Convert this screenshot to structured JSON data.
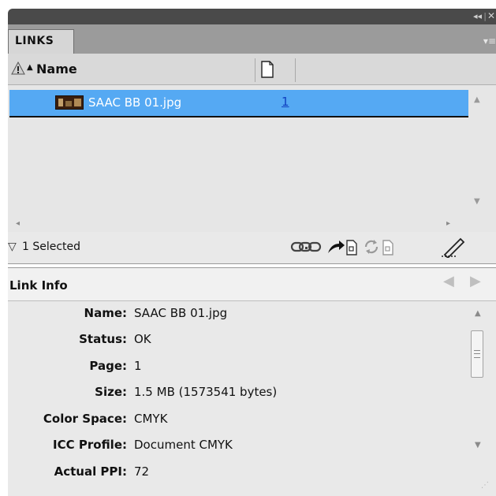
{
  "chrome": {
    "collapse_glyph": "◂◂",
    "separator": "|",
    "close_glyph": "✕"
  },
  "panel": {
    "tab_label": "LINKS",
    "menu_glyph": "▾≡"
  },
  "columns": {
    "warning_icon": "warning-triangle-icon",
    "sort_glyph": "▲",
    "name_header": "Name",
    "page_icon": "page-icon"
  },
  "list": {
    "rows": [
      {
        "name": "SAAC BB 01.jpg",
        "page": "1",
        "selected": true,
        "thumbnail_icon": "image-thumbnail-icon"
      }
    ],
    "scroll_up": "▲",
    "scroll_down": "▼",
    "scroll_left": "◂",
    "scroll_right": "▸"
  },
  "status": {
    "toggle_glyph": "▽",
    "selected_text": "1 Selected",
    "icons": [
      "relink-icon",
      "go-to-link-icon",
      "update-link-icon",
      "edit-original-icon"
    ]
  },
  "link_info": {
    "title": "Link Info",
    "prev_glyph": "◀",
    "next_glyph": "▶",
    "fields": [
      {
        "label": "Name:",
        "value": "SAAC BB 01.jpg"
      },
      {
        "label": "Status:",
        "value": "OK"
      },
      {
        "label": "Page:",
        "value": "1"
      },
      {
        "label": "Size:",
        "value": "1.5 MB (1573541 bytes)"
      },
      {
        "label": "Color Space:",
        "value": "CMYK"
      },
      {
        "label": "ICC Profile:",
        "value": "Document CMYK"
      },
      {
        "label": "Actual PPI:",
        "value": "72"
      }
    ],
    "scroll_up": "▲",
    "scroll_down": "▼",
    "resize_glyph": "⋰"
  },
  "colors": {
    "chrome": "#4a4a4a",
    "tab_strip": "#9b9b9b",
    "selection": "#55a9f3",
    "panel_bg": "#e6e6e6",
    "link_color": "#1040c0"
  }
}
